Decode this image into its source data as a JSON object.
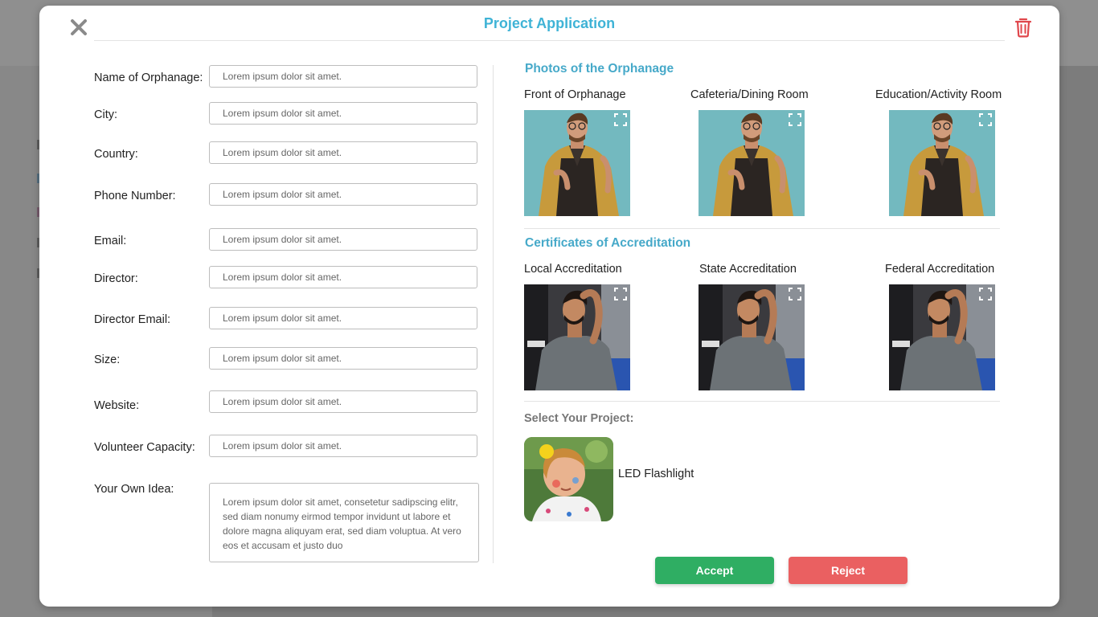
{
  "modal": {
    "title": "Project Application",
    "close_icon": "close-icon",
    "delete_icon": "trash-icon"
  },
  "form": {
    "fields": [
      {
        "label": "Name of Orphanage:",
        "placeholder": "Lorem ipsum dolor sit amet."
      },
      {
        "label": "City:",
        "placeholder": "Lorem ipsum dolor sit amet."
      },
      {
        "label": "Country:",
        "placeholder": "Lorem ipsum dolor sit amet."
      },
      {
        "label": "Phone Number:",
        "placeholder": "Lorem ipsum dolor sit amet."
      },
      {
        "label": "Email:",
        "placeholder": "Lorem ipsum dolor sit amet."
      },
      {
        "label": "Director:",
        "placeholder": "Lorem ipsum dolor sit amet."
      },
      {
        "label": "Director Email:",
        "placeholder": "Lorem ipsum dolor sit amet."
      },
      {
        "label": "Size:",
        "placeholder": "Lorem ipsum dolor sit amet."
      },
      {
        "label": "Website:",
        "placeholder": "Lorem ipsum dolor sit amet."
      },
      {
        "label": "Volunteer Capacity:",
        "placeholder": "Lorem ipsum dolor sit amet."
      }
    ],
    "idea": {
      "label": "Your Own Idea:",
      "value": "Lorem ipsum dolor sit amet, consetetur sadipscing elitr, sed diam nonumy eirmod tempor invidunt ut labore et dolore magna aliquyam erat, sed diam voluptua. At vero eos et accusam et justo duo"
    }
  },
  "photos": {
    "title": "Photos of the Orphanage",
    "items": [
      {
        "label": "Front of Orphanage"
      },
      {
        "label": "Cafeteria/Dining Room"
      },
      {
        "label": "Education/Activity Room"
      }
    ]
  },
  "certificates": {
    "title": "Certificates of Accreditation",
    "items": [
      {
        "label": "Local Accreditation"
      },
      {
        "label": "State Accreditation"
      },
      {
        "label": "Federal Accreditation"
      }
    ]
  },
  "project": {
    "title": "Select Your Project:",
    "name": "LED Flashlight"
  },
  "actions": {
    "accept": "Accept",
    "reject": "Reject"
  },
  "colors": {
    "title": "#3fb3d6",
    "section": "#46a9c9",
    "accept": "#2fae63",
    "reject": "#ea6061",
    "trash": "#e0474c"
  }
}
